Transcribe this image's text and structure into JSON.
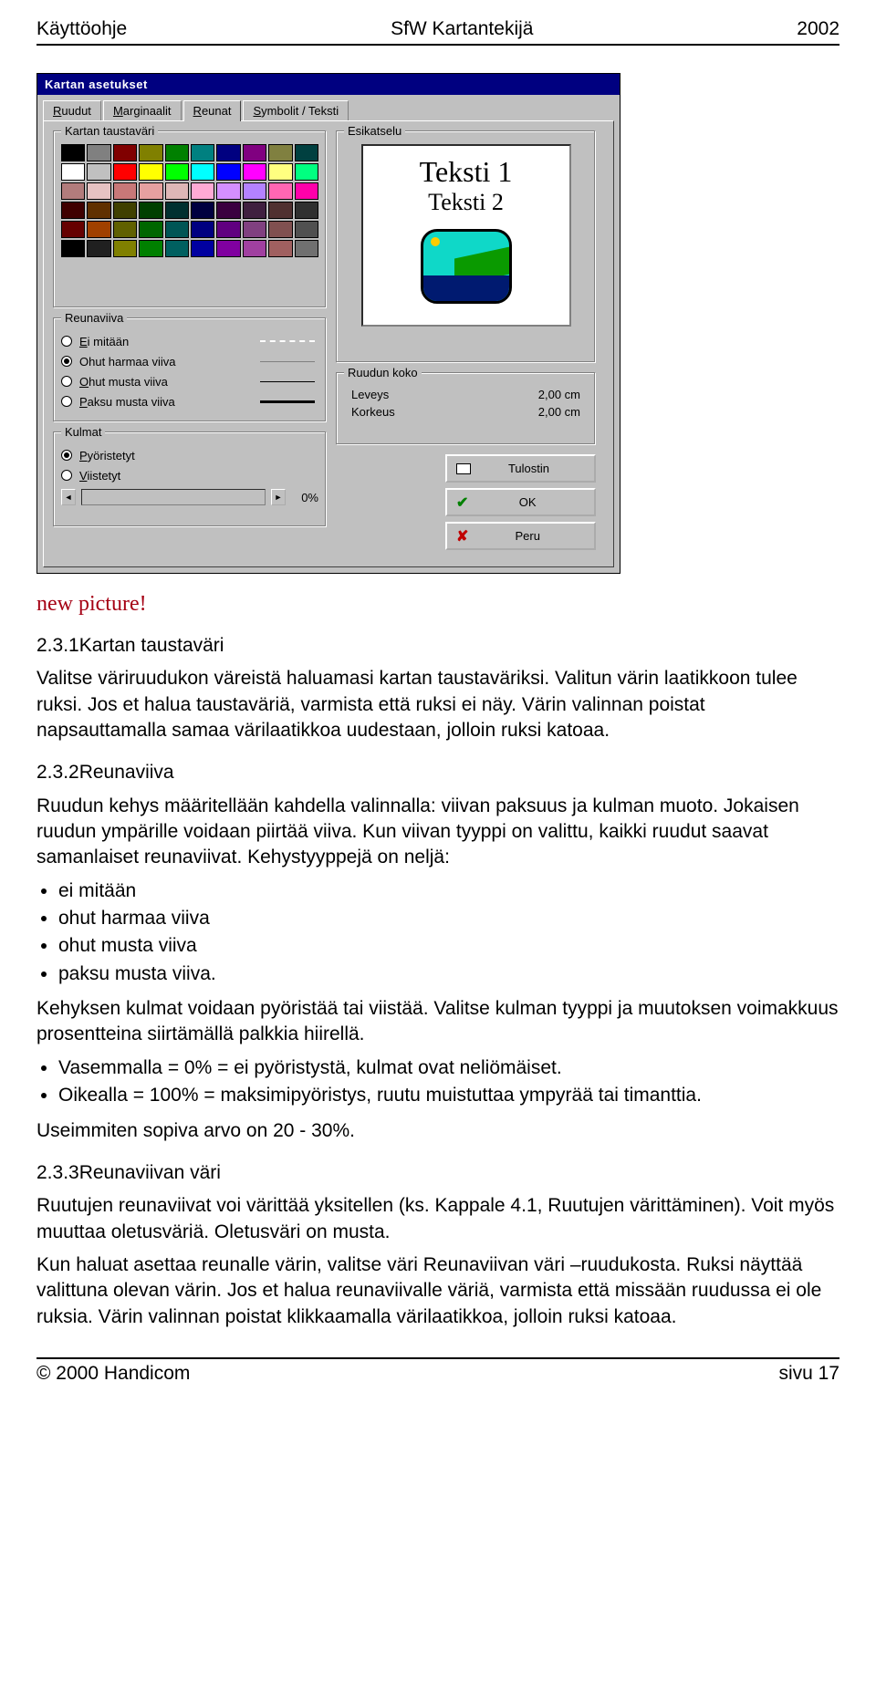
{
  "header": {
    "left": "Käyttöohje",
    "center": "SfW Kartantekijä",
    "right": "2002"
  },
  "dialog": {
    "title": "Kartan asetukset",
    "tabs": [
      {
        "label": "Ruudut",
        "key": "R"
      },
      {
        "label": "Marginaalit",
        "key": "M"
      },
      {
        "label": "Reunat",
        "key": "R",
        "active": true
      },
      {
        "label": "Symbolit / Teksti",
        "key": "S"
      }
    ],
    "groups": {
      "bgcolor": "Kartan taustaväri",
      "border": "Reunaviiva",
      "corner": "Kulmat",
      "preview": "Esikatselu",
      "size": "Ruudun koko"
    },
    "colors": {
      "row1": [
        "#000000",
        "#808080",
        "#800000",
        "#808000",
        "#008000",
        "#008080",
        "#000080",
        "#800080",
        "#808040",
        "#004040"
      ],
      "row2": [
        "#ffffff",
        "#c0c0c0",
        "#ff0000",
        "#ffff00",
        "#00ff00",
        "#00ffff",
        "#0000ff",
        "#ff00ff",
        "#ffff80",
        "#00ff80"
      ],
      "row3": [
        "#b27c7c",
        "#e6c2c2",
        "#c87878",
        "#e6a0a0",
        "#deb6b6",
        "#ffaad4",
        "#d48fff",
        "#b482ff",
        "#ff66b3",
        "#ff00aa"
      ],
      "row4": [
        "#400000",
        "#603000",
        "#404000",
        "#004000",
        "#003030",
        "#000040",
        "#3a0040",
        "#402040",
        "#503030",
        "#303030"
      ],
      "row5": [
        "#660000",
        "#a04000",
        "#606000",
        "#006600",
        "#005555",
        "#000080",
        "#600080",
        "#804080",
        "#805050",
        "#505050"
      ],
      "row6": [
        "#000000",
        "#202020",
        "#808000",
        "#008000",
        "#006060",
        "#0000a0",
        "#8000a0",
        "#a040a0",
        "#a06060",
        "#707070"
      ]
    },
    "border_options": [
      {
        "label": "Ei mitään",
        "selected": false,
        "line": "none",
        "key": "E"
      },
      {
        "label": "Ohut harmaa viiva",
        "selected": true,
        "line": "g"
      },
      {
        "label": "Ohut musta viiva",
        "selected": false,
        "line": "b",
        "key": "O"
      },
      {
        "label": "Paksu musta viiva",
        "selected": false,
        "line": "t",
        "key": "P"
      }
    ],
    "corner_options": [
      {
        "label": "Pyöristetyt",
        "selected": true,
        "key": "P"
      },
      {
        "label": "Viistetyt",
        "selected": false,
        "key": "V"
      }
    ],
    "slider_value": "0%",
    "preview": {
      "text1": "Teksti 1",
      "text2": "Teksti 2"
    },
    "size": {
      "width_label": "Leveys",
      "width_val": "2,00 cm",
      "height_label": "Korkeus",
      "height_val": "2,00 cm"
    },
    "buttons": {
      "printer": "Tulostin",
      "ok": "OK",
      "cancel": "Peru"
    }
  },
  "new_picture": "new picture!",
  "doc": {
    "h1": "2.3.1Kartan taustaväri",
    "p1": "Valitse väriruudukon väreistä haluamasi kartan taustaväriksi. Valitun värin laatikkoon tulee ruksi. Jos et halua taustaväriä, varmista että ruksi ei näy. Värin valinnan poistat napsauttamalla samaa värilaatikkoa uudestaan, jolloin ruksi katoaa.",
    "h2": "2.3.2Reunaviiva",
    "p2": "Ruudun kehys määritellään kahdella valinnalla: viivan paksuus ja kulman muoto. Jokaisen ruudun ympärille voidaan piirtää viiva. Kun viivan tyyppi on valittu, kaikki ruudut saavat samanlaiset reunaviivat. Kehystyyppejä on neljä:",
    "list1": [
      "ei mitään",
      "ohut harmaa viiva",
      "ohut musta viiva",
      "paksu musta viiva."
    ],
    "p3": "Kehyksen kulmat voidaan pyöristää tai viistää. Valitse kulman tyyppi ja muutoksen voimakkuus prosentteina siirtämällä palkkia hiirellä.",
    "list2": [
      "Vasemmalla = 0% = ei pyöristystä, kulmat ovat neliömäiset.",
      "Oikealla = 100% = maksimipyöristys, ruutu muistuttaa ympyrää tai timanttia."
    ],
    "p4": "Useimmiten sopiva arvo on  20 - 30%.",
    "h3": "2.3.3Reunaviivan väri",
    "p5": "Ruutujen reunaviivat voi värittää yksitellen (ks. Kappale 4.1, Ruutujen värittäminen). Voit myös muuttaa oletusväriä. Oletusväri on musta.",
    "p6": "Kun haluat asettaa reunalle värin, valitse väri Reunaviivan väri –ruudukosta. Ruksi näyttää valittuna olevan värin. Jos et halua reunaviivalle väriä, varmista että missään ruudussa ei ole ruksia. Värin valinnan poistat klikkaamalla värilaatikkoa, jolloin ruksi katoaa."
  },
  "footer": {
    "left": "© 2000 Handicom",
    "right": "sivu 17"
  }
}
